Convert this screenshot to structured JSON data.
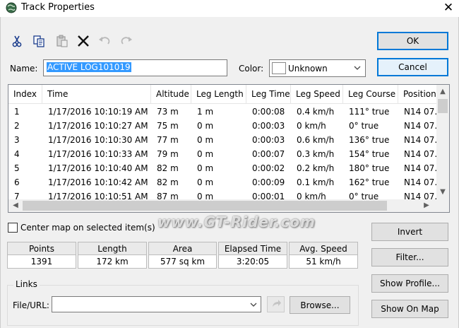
{
  "window": {
    "title": "Track Properties",
    "close_glyph": "✕"
  },
  "toolbar": {
    "icons": [
      "cut-icon",
      "copy-icon",
      "paste-icon",
      "delete-icon",
      "undo-icon",
      "redo-icon"
    ]
  },
  "buttons": {
    "ok": "OK",
    "cancel": "Cancel",
    "invert": "Invert",
    "filter": "Filter...",
    "show_profile": "Show Profile...",
    "show_on_map": "Show On Map",
    "browse": "Browse..."
  },
  "name": {
    "label": "Name:",
    "value": "ACTIVE LOG101019"
  },
  "color": {
    "label": "Color:",
    "value": "Unknown"
  },
  "table": {
    "columns": [
      "Index",
      "Time",
      "Altitude",
      "Leg Length",
      "Leg Time",
      "Leg Speed",
      "Leg Course",
      "Position"
    ],
    "rows": [
      [
        "1",
        "1/17/2016 10:10:19 AM",
        "73 m",
        "1 m",
        "0:00:08",
        "0.4 km/h",
        "111° true",
        "N14 07."
      ],
      [
        "2",
        "1/17/2016 10:10:27 AM",
        "75 m",
        "0 m",
        "0:00:03",
        "0 km/h",
        "0° true",
        "N14 07."
      ],
      [
        "3",
        "1/17/2016 10:10:30 AM",
        "77 m",
        "0 m",
        "0:00:03",
        "0.6 km/h",
        "136° true",
        "N14 07."
      ],
      [
        "4",
        "1/17/2016 10:10:33 AM",
        "79 m",
        "0 m",
        "0:00:07",
        "0.3 km/h",
        "154° true",
        "N14 07."
      ],
      [
        "5",
        "1/17/2016 10:10:40 AM",
        "82 m",
        "0 m",
        "0:00:02",
        "0.2 km/h",
        "180° true",
        "N14 07."
      ],
      [
        "6",
        "1/17/2016 10:10:42 AM",
        "82 m",
        "0 m",
        "0:00:09",
        "0.1 km/h",
        "162° true",
        "N14 07."
      ],
      [
        "7",
        "1/17/2016 10:10:51 AM",
        "87 m",
        "0 m",
        "0:00:01",
        "0 km/h",
        "0° true",
        "N14 07."
      ]
    ]
  },
  "center_map": {
    "label": "Center map on selected item(s)",
    "checked": false
  },
  "stats": [
    {
      "label": "Points",
      "value": "1391"
    },
    {
      "label": "Length",
      "value": "172 km"
    },
    {
      "label": "Area",
      "value": "577 sq km"
    },
    {
      "label": "Elapsed Time",
      "value": "3:20:05"
    },
    {
      "label": "Avg. Speed",
      "value": "51 km/h"
    }
  ],
  "links": {
    "group_label": "Links",
    "field_label": "File/URL:",
    "value": ""
  },
  "watermark": "www.GT-Rider.com"
}
